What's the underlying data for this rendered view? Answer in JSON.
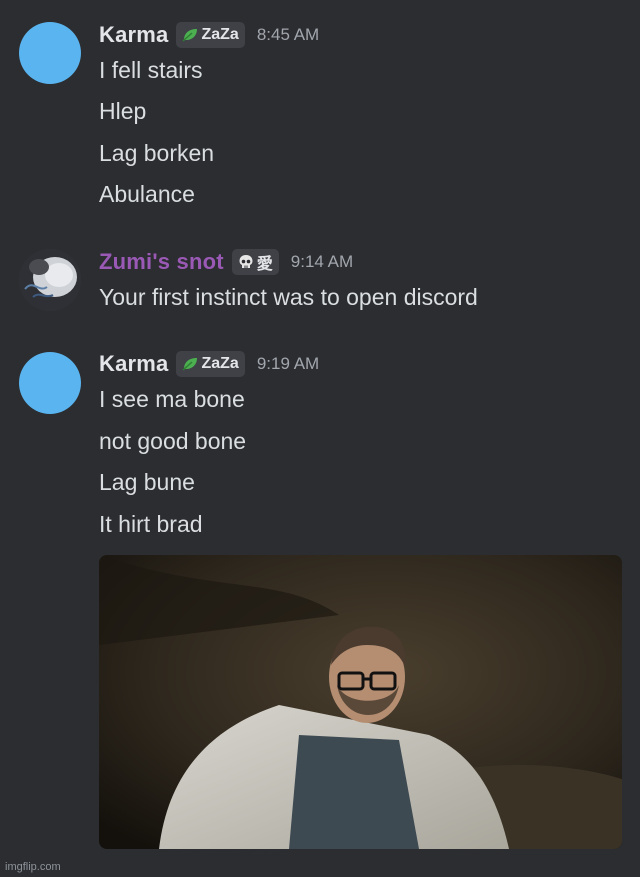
{
  "messages": [
    {
      "username": "Karma",
      "tag": "ZaZa",
      "tag_icon": "leaf-icon",
      "time": "8:45 AM",
      "avatar_color": "#5ab4ef",
      "lines": [
        "I fell stairs",
        "Hlep",
        "Lag borken",
        "Abulance"
      ]
    },
    {
      "username": "Zumi's snot",
      "tag": "愛",
      "tag_icon": "skull-icon",
      "time": "9:14 AM",
      "lines": [
        "Your first instinct was to open discord"
      ]
    },
    {
      "username": "Karma",
      "tag": "ZaZa",
      "tag_icon": "leaf-icon",
      "time": "9:19 AM",
      "avatar_color": "#5ab4ef",
      "lines": [
        "I see ma bone",
        "not good bone",
        "Lag bune",
        "It hirt brad"
      ],
      "attachment": "gif-image"
    }
  ],
  "colors": {
    "background": "#2b2d31",
    "karma_name": "#e3e5e8",
    "zumi_name": "#9b59b6",
    "timestamp": "#a2a6ad",
    "message_text": "#dbdee1"
  },
  "watermark": "imgflip.com"
}
